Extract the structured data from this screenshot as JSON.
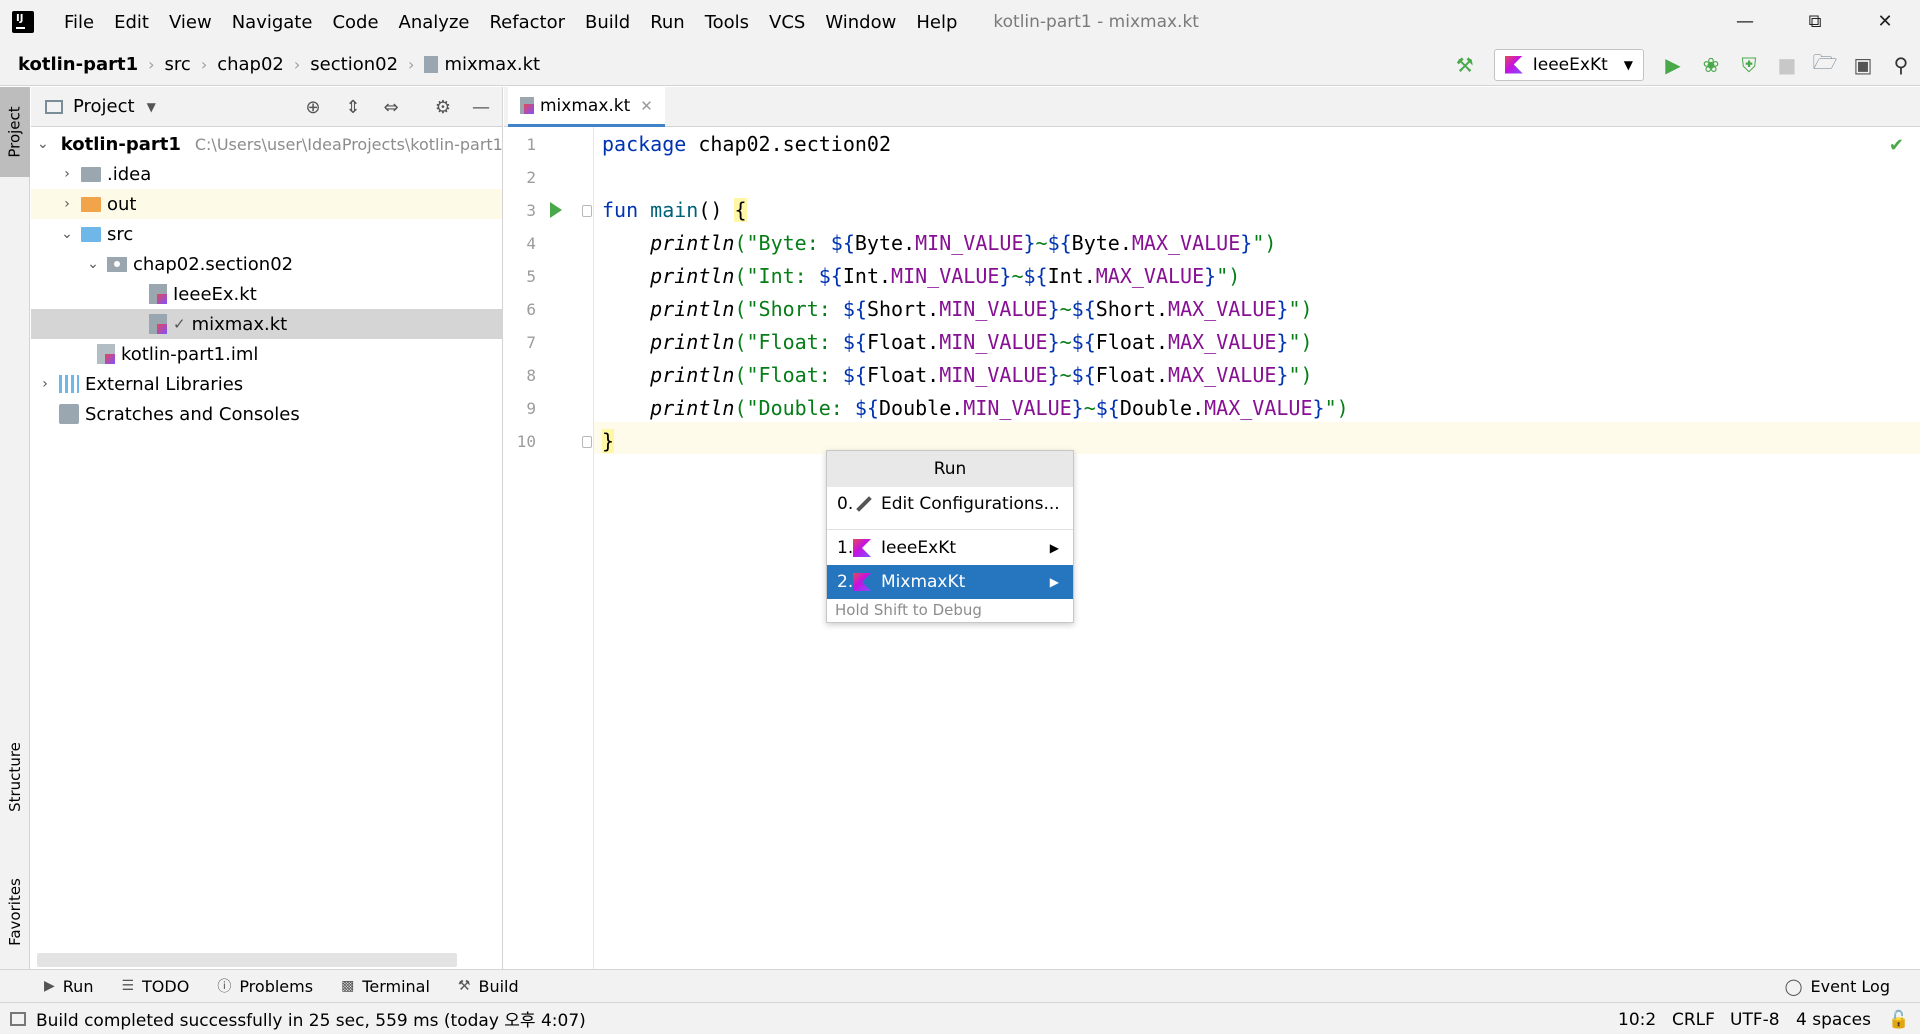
{
  "window": {
    "title": "kotlin-part1 - mixmax.kt",
    "menu": [
      "File",
      "Edit",
      "View",
      "Navigate",
      "Code",
      "Analyze",
      "Refactor",
      "Build",
      "Run",
      "Tools",
      "VCS",
      "Window",
      "Help"
    ]
  },
  "breadcrumb": [
    "kotlin-part1",
    "src",
    "chap02",
    "section02",
    "mixmax.kt"
  ],
  "toolbar": {
    "run_config": "IeeeExKt"
  },
  "side_tabs": {
    "project": "Project",
    "structure": "Structure",
    "favorites": "Favorites"
  },
  "project_panel": {
    "title": "Project",
    "tree": [
      {
        "label": "kotlin-part1",
        "hint": "C:\\Users\\user\\IdeaProjects\\kotlin-part1"
      },
      {
        "label": ".idea"
      },
      {
        "label": "out"
      },
      {
        "label": "src"
      },
      {
        "label": "chap02.section02"
      },
      {
        "label": "IeeeEx.kt"
      },
      {
        "label": "mixmax.kt"
      },
      {
        "label": "kotlin-part1.iml"
      },
      {
        "label": "External Libraries"
      },
      {
        "label": "Scratches and Consoles"
      }
    ]
  },
  "editor": {
    "tab": "mixmax.kt",
    "line_numbers": [
      "1",
      "2",
      "3",
      "4",
      "5",
      "6",
      "7",
      "8",
      "9",
      "10"
    ],
    "code": {
      "l1_kw": "package",
      "l1_rest": " chap02.section02",
      "l3_kw": "fun",
      "l3_name": " main",
      "l3_rest": "() ",
      "l3_brace": "{",
      "println": "println",
      "lines": [
        {
          "prefix": "(\"Byte: ${",
          "type": "Byte"
        },
        {
          "prefix": "(\"Int: ${",
          "type": "Int"
        },
        {
          "prefix": "(\"Short: ${",
          "type": "Short"
        },
        {
          "prefix": "(\"Float: ${",
          "type": "Float"
        },
        {
          "prefix": "(\"Float: ${",
          "type": "Float"
        },
        {
          "prefix": "(\"Double: ${",
          "type": "Double"
        }
      ],
      "min": "MIN_VALUE",
      "max": "MAX_VALUE",
      "mid": "}~${",
      "end": "}\")",
      "dot": ".",
      "l10_brace": "}"
    }
  },
  "popup": {
    "title": "Run",
    "items": [
      {
        "num": "0.",
        "label": "Edit Configurations..."
      },
      {
        "num": "1.",
        "label": "IeeeExKt"
      },
      {
        "num": "2.",
        "label": "MixmaxKt"
      }
    ],
    "hint": "Hold Shift to Debug"
  },
  "bottom_tools": [
    "Run",
    "TODO",
    "Problems",
    "Terminal",
    "Build"
  ],
  "event_log": "Event Log",
  "status": {
    "message": "Build completed successfully in 25 sec, 559 ms (today 오후 4:07)",
    "position": "10:2",
    "line_sep": "CRLF",
    "encoding": "UTF-8",
    "indent": "4 spaces"
  }
}
